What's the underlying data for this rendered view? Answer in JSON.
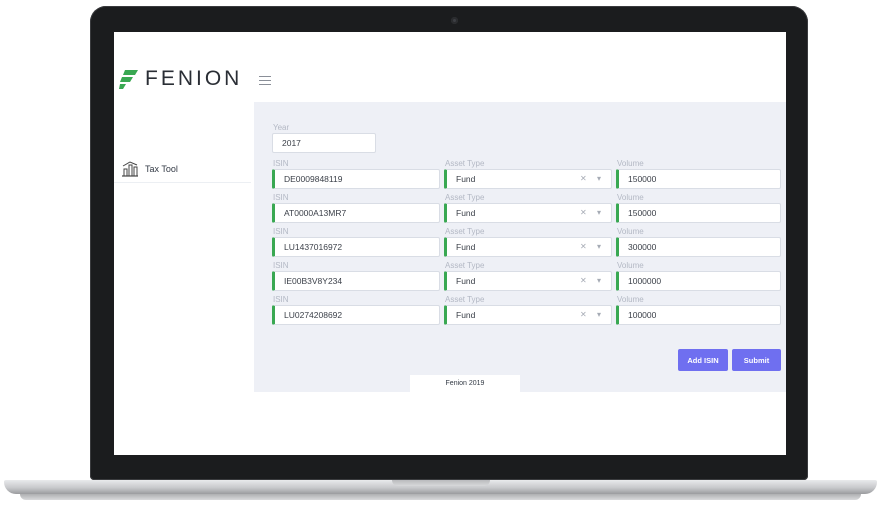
{
  "app": {
    "brand": "FENION",
    "brand_color": "#39a852",
    "accent_color": "#6f6ff0"
  },
  "sidebar": {
    "items": [
      {
        "label": "Tax Tool",
        "icon": "bar-chart-building-icon"
      }
    ]
  },
  "form": {
    "year_label": "Year",
    "year_value": "2017",
    "rows": [
      {
        "isin_label": "ISIN",
        "isin": "DE0009848119",
        "asset_label": "Asset Type",
        "asset": "Fund",
        "volume_label": "Volume",
        "volume": "150000"
      },
      {
        "isin_label": "ISIN",
        "isin": "AT0000A13MR7",
        "asset_label": "Asset Type",
        "asset": "Fund",
        "volume_label": "Volume",
        "volume": "150000"
      },
      {
        "isin_label": "ISIN",
        "isin": "LU1437016972",
        "asset_label": "Asset Type",
        "asset": "Fund",
        "volume_label": "Volume",
        "volume": "300000"
      },
      {
        "isin_label": "ISIN",
        "isin": "IE00B3V8Y234",
        "asset_label": "Asset Type",
        "asset": "Fund",
        "volume_label": "Volume",
        "volume": "1000000"
      },
      {
        "isin_label": "ISIN",
        "isin": "LU0274208692",
        "asset_label": "Asset Type",
        "asset": "Fund",
        "volume_label": "Volume",
        "volume": "100000"
      }
    ],
    "add_label": "Add ISIN",
    "submit_label": "Submit"
  },
  "footer": {
    "text": "Fenion  2019"
  }
}
